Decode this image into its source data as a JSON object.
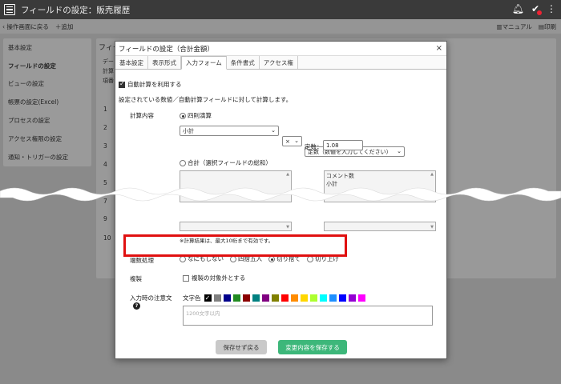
{
  "app": {
    "title": "フィールドの設定：販売履歴"
  },
  "subbar": {
    "back": "操作画面に戻る",
    "add": "追加",
    "manual": "マニュアル",
    "print": "印刷"
  },
  "sidebar": {
    "items": [
      {
        "label": "基本設定"
      },
      {
        "label": "フィールドの設定"
      },
      {
        "label": "ビューの設定"
      },
      {
        "label": "帳票の設定(Excel)"
      },
      {
        "label": "プロセスの設定"
      },
      {
        "label": "アクセス権限の設定"
      },
      {
        "label": "通知・トリガーの設定"
      }
    ]
  },
  "background": {
    "heading": "フィー",
    "text1": "デー",
    "text2": "計算",
    "text3": "項番",
    "row_numbers": [
      "1",
      "2",
      "3",
      "4",
      "5",
      "6",
      "7",
      "8",
      "9",
      "10"
    ]
  },
  "dialog": {
    "title": "フィールドの設定（合計金額）",
    "close": "×",
    "tabs": [
      "基本設定",
      "表示形式",
      "入力フォーム",
      "条件書式",
      "アクセス権"
    ],
    "active_tab": "入力フォーム",
    "auto_calc_label": "自動計算を利用する",
    "description": "設定されている数値／自動計算フィールドに対して計算します。",
    "calc_label": "計算内容",
    "arith_label": "四則演算",
    "field_select": "小計",
    "operator_select": "×",
    "const_select": "定数（数値を入力してください）",
    "const_label": "定数：",
    "const_value": "1.08",
    "sum_label": "合計（選択フィールドの総和）",
    "right_list": [
      "コメント数",
      "小計"
    ],
    "note": "※計算結果は、最大10桁まで有効です。",
    "rounding_label": "端数処理",
    "rounding_options": [
      "なにもしない",
      "四捨五入",
      "切り捨て",
      "切り上げ"
    ],
    "rounding_selected": "切り捨て",
    "recalc_label": "複製",
    "recalc_checkbox": "複製の対象外とする",
    "notes_label": "入力時の注意文",
    "help_icon": "?",
    "text_color_label": "文字色",
    "colors": [
      "#000000",
      "#808080",
      "#00008b",
      "#228b22",
      "#8b0000",
      "#008080",
      "#800080",
      "#808000",
      "#ff0000",
      "#ff8c00",
      "#ffd700",
      "#adff2f",
      "#00ffff",
      "#1e90ff",
      "#0000ff",
      "#9400d3",
      "#ff00ff"
    ],
    "notes_placeholder": "1200文字以内",
    "cancel_button": "保存せず戻る",
    "save_button": "変更内容を保存する"
  }
}
